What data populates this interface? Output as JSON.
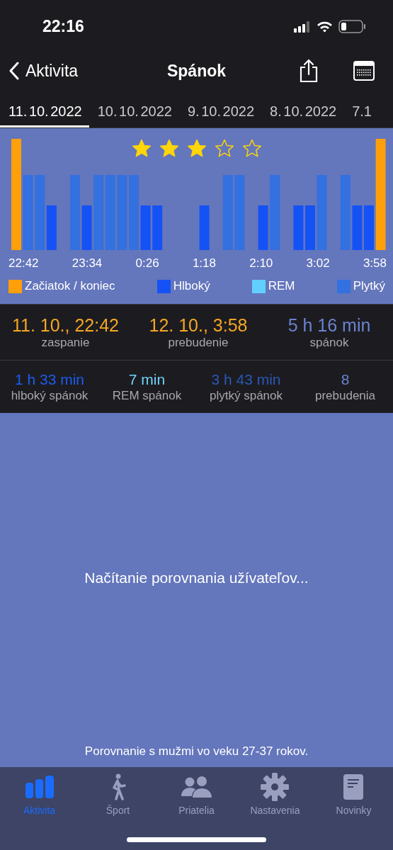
{
  "status_bar": {
    "time": "22:16"
  },
  "nav": {
    "back": "Aktivita",
    "title": "Spánok"
  },
  "date_tabs": [
    {
      "label": "11. 10. 2022",
      "selected": true
    },
    {
      "label": "10. 10. 2022",
      "selected": false
    },
    {
      "label": "9. 10. 2022",
      "selected": false
    },
    {
      "label": "8. 10. 2022",
      "selected": false
    },
    {
      "label": "7.1",
      "selected": false
    }
  ],
  "chart": {
    "stars": 3,
    "bars": [
      {
        "kind": "marker"
      },
      {
        "kind": "light"
      },
      {
        "kind": "light"
      },
      {
        "kind": "deep"
      },
      {
        "kind": "none"
      },
      {
        "kind": "light"
      },
      {
        "kind": "deep"
      },
      {
        "kind": "light"
      },
      {
        "kind": "light"
      },
      {
        "kind": "light"
      },
      {
        "kind": "light"
      },
      {
        "kind": "deep"
      },
      {
        "kind": "deep"
      },
      {
        "kind": "none"
      },
      {
        "kind": "none"
      },
      {
        "kind": "none"
      },
      {
        "kind": "deep"
      },
      {
        "kind": "none"
      },
      {
        "kind": "light"
      },
      {
        "kind": "light"
      },
      {
        "kind": "none"
      },
      {
        "kind": "deep"
      },
      {
        "kind": "light"
      },
      {
        "kind": "none"
      },
      {
        "kind": "deep"
      },
      {
        "kind": "deep"
      },
      {
        "kind": "light"
      },
      {
        "kind": "none"
      },
      {
        "kind": "light"
      },
      {
        "kind": "deep"
      },
      {
        "kind": "deep"
      },
      {
        "kind": "marker"
      }
    ],
    "times": [
      "22:42",
      "23:34",
      "0:26",
      "1:18",
      "2:10",
      "3:02",
      "3:58"
    ],
    "legend": [
      {
        "label": "Začiatok / koniec",
        "color": "#ff9f0a"
      },
      {
        "label": "Hlboký",
        "color": "#1452f5"
      },
      {
        "label": "REM",
        "color": "#62d0ff"
      },
      {
        "label": "Plytký",
        "color": "#3370e0"
      }
    ]
  },
  "summary": [
    {
      "value": "11. 10., 22:42",
      "label": "zaspanie",
      "color": "#f5a623"
    },
    {
      "value": "12. 10., 3:58",
      "label": "prebudenie",
      "color": "#f5a623"
    },
    {
      "value": "5 h 16 min",
      "label": "spánok",
      "color": "#6b82d0"
    }
  ],
  "details": [
    {
      "value": "1 h 33 min",
      "label": "hlboký spánok",
      "color": "#1a5df0"
    },
    {
      "value": "7 min",
      "label": "REM spánok",
      "color": "#6fd3ff"
    },
    {
      "value": "3 h 43 min",
      "label": "plytký spánok",
      "color": "#2a58b8"
    },
    {
      "value": "8",
      "label": "prebudenia",
      "color": "#6b82d0"
    }
  ],
  "comparison": {
    "loading": "Načítanie porovnania užívateľov...",
    "footnote": "Porovnanie s mužmi vo veku 27-37 rokov."
  },
  "tab_bar": [
    {
      "label": "Aktivita",
      "kind": "activity",
      "selected": true
    },
    {
      "label": "Šport",
      "kind": "sport",
      "selected": false
    },
    {
      "label": "Priatelia",
      "kind": "friends",
      "selected": false
    },
    {
      "label": "Nastavenia",
      "kind": "settings",
      "selected": false
    },
    {
      "label": "Novinky",
      "kind": "news",
      "selected": false
    }
  ]
}
